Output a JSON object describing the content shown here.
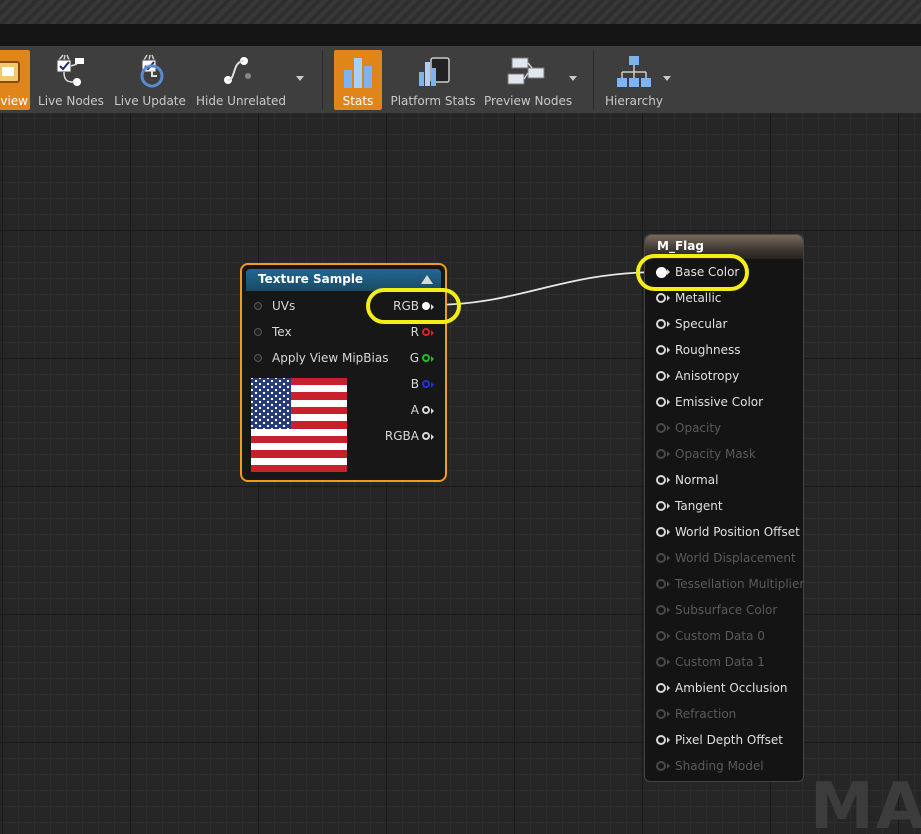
{
  "toolbar": {
    "buttons": [
      {
        "id": "preview",
        "label": "view",
        "icon": "preview-icon",
        "active": true
      },
      {
        "id": "live-nodes",
        "label": "Live Nodes",
        "icon": "live-nodes-icon"
      },
      {
        "id": "live-update",
        "label": "Live Update",
        "icon": "live-update-icon"
      },
      {
        "id": "hide-unrelated",
        "label": "Hide Unrelated",
        "icon": "hide-unrelated-icon"
      },
      {
        "id": "stats",
        "label": "Stats",
        "icon": "stats-icon",
        "active": true
      },
      {
        "id": "platform-stats",
        "label": "Platform Stats",
        "icon": "platform-stats-icon"
      },
      {
        "id": "preview-nodes",
        "label": "Preview Nodes",
        "icon": "preview-nodes-icon"
      },
      {
        "id": "hierarchy",
        "label": "Hierarchy",
        "icon": "hierarchy-icon"
      }
    ],
    "active_color": "#e0851a"
  },
  "texture_node": {
    "title": "Texture Sample",
    "inputs": [
      "UVs",
      "Tex",
      "Apply View MipBias"
    ],
    "outputs": [
      {
        "label": "RGB",
        "color": "#ffffff",
        "connected": true
      },
      {
        "label": "R",
        "color": "#e02020"
      },
      {
        "label": "G",
        "color": "#20c020"
      },
      {
        "label": "B",
        "color": "#2030e0"
      },
      {
        "label": "A",
        "color": "#d8d8d8"
      },
      {
        "label": "RGBA",
        "color": "#d8d8d8"
      }
    ],
    "preview": "us-flag-texture"
  },
  "material_node": {
    "title": "M_Flag",
    "inputs": [
      {
        "label": "Base Color",
        "enabled": true,
        "connected": true
      },
      {
        "label": "Metallic",
        "enabled": true
      },
      {
        "label": "Specular",
        "enabled": true
      },
      {
        "label": "Roughness",
        "enabled": true
      },
      {
        "label": "Anisotropy",
        "enabled": true
      },
      {
        "label": "Emissive Color",
        "enabled": true
      },
      {
        "label": "Opacity",
        "enabled": false
      },
      {
        "label": "Opacity Mask",
        "enabled": false
      },
      {
        "label": "Normal",
        "enabled": true
      },
      {
        "label": "Tangent",
        "enabled": true
      },
      {
        "label": "World Position Offset",
        "enabled": true
      },
      {
        "label": "World Displacement",
        "enabled": false
      },
      {
        "label": "Tessellation Multiplier",
        "enabled": false
      },
      {
        "label": "Subsurface Color",
        "enabled": false
      },
      {
        "label": "Custom Data 0",
        "enabled": false
      },
      {
        "label": "Custom Data 1",
        "enabled": false
      },
      {
        "label": "Ambient Occlusion",
        "enabled": true
      },
      {
        "label": "Refraction",
        "enabled": false
      },
      {
        "label": "Pixel Depth Offset",
        "enabled": true
      },
      {
        "label": "Shading Model",
        "enabled": false
      }
    ]
  },
  "watermark": "MAT",
  "highlight_color": "#f3ee14"
}
